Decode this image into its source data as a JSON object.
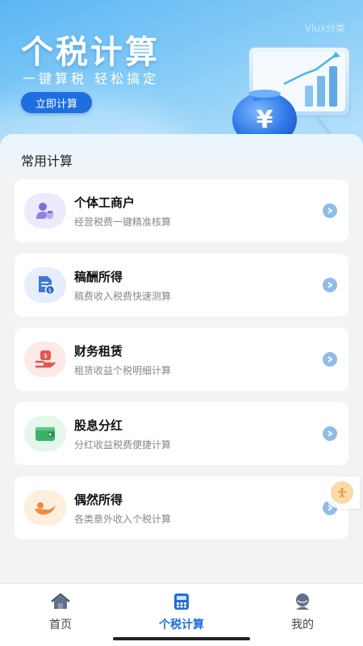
{
  "banner": {
    "title": "个税计算",
    "subtitle": "一键算税 轻松搞定",
    "cta_label": "立即计算",
    "watermark": "Vlux分类",
    "illustration_icon": "money-bag-chart-illustration"
  },
  "section": {
    "title": "常用计算"
  },
  "items": [
    {
      "title": "个体工商户",
      "desc": "经营税费一键精准核算",
      "icon": "merchant-icon",
      "icon_bg": "#eceafb",
      "icon_color": "#7b73d8"
    },
    {
      "title": "稿酬所得",
      "desc": "稿费收入税费快速测算",
      "icon": "document-icon",
      "icon_bg": "#e6eefb",
      "icon_color": "#3f79d6"
    },
    {
      "title": "财务租赁",
      "desc": "租赁收益个税明细计算",
      "icon": "money-hand-icon",
      "icon_bg": "#fde9e9",
      "icon_color": "#e2574c"
    },
    {
      "title": "股息分红",
      "desc": "分红收益税费便捷计算",
      "icon": "wallet-icon",
      "icon_bg": "#e5f6ea",
      "icon_color": "#3ab36a"
    },
    {
      "title": "偶然所得",
      "desc": "各类意外收入个税计算",
      "icon": "gift-icon",
      "icon_bg": "#fdeedd",
      "icon_color": "#f08a3c"
    }
  ],
  "tabs": [
    {
      "label": "首页",
      "icon": "home-icon",
      "active": false
    },
    {
      "label": "个税计算",
      "icon": "calculator-icon",
      "active": true
    },
    {
      "label": "我的",
      "icon": "user-icon",
      "active": false
    }
  ],
  "colors": {
    "primary": "#1d6fe0",
    "arrow": "#8fbde8",
    "background": "#f2f3f5"
  },
  "float_button_icon": "accessibility-icon"
}
